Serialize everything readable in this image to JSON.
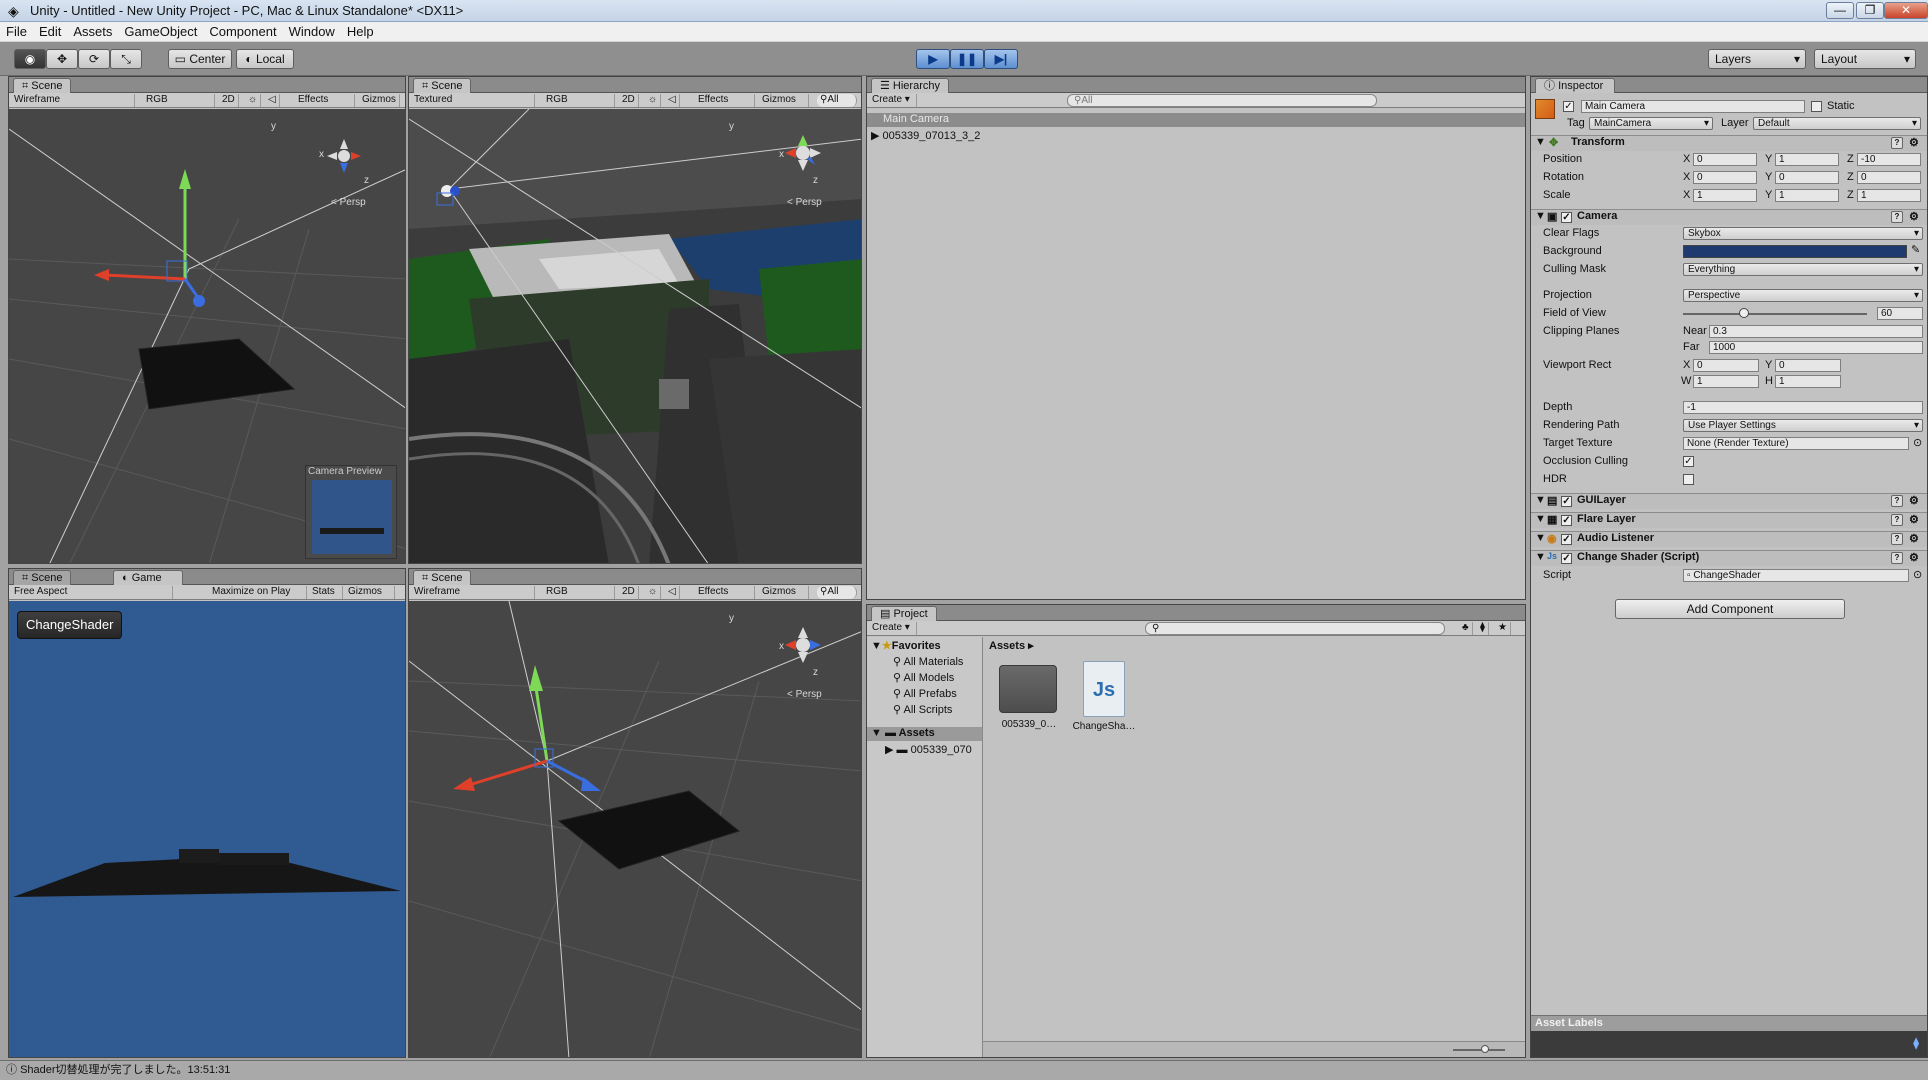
{
  "window": {
    "title": "Unity - Untitled - New Unity Project - PC, Mac & Linux Standalone* <DX11>",
    "minimize": "—",
    "maximize": "❐",
    "close": "✕"
  },
  "menu": [
    "File",
    "Edit",
    "Assets",
    "GameObject",
    "Component",
    "Window",
    "Help"
  ],
  "toolbar": {
    "tools": [
      "hand-icon",
      "move-icon",
      "rotate-icon",
      "scale-icon"
    ],
    "pivot": "Center",
    "space": "Local",
    "play": "▶",
    "pause": "❚❚",
    "step": "▶|",
    "layers": "Layers",
    "layout": "Layout"
  },
  "scene_top_left": {
    "tab": "Scene",
    "draw_mode": "Wireframe",
    "rgb": "RGB",
    "btn_2d": "2D",
    "effects": "Effects",
    "gizmos": "Gizmos",
    "persp": "Persp",
    "gizmo_x": "x",
    "gizmo_y": "y",
    "gizmo_z": "z",
    "camera_preview": "Camera Preview"
  },
  "scene_top_mid": {
    "tab": "Scene",
    "draw_mode": "Textured",
    "rgb": "RGB",
    "btn_2d": "2D",
    "effects": "Effects",
    "gizmos": "Gizmos",
    "search": "All",
    "persp": "Persp",
    "gizmo_x": "x",
    "gizmo_y": "y",
    "gizmo_z": "z"
  },
  "game_panel": {
    "tab_scene": "Scene",
    "tab_game": "Game",
    "aspect": "Free Aspect",
    "maximize": "Maximize on Play",
    "stats": "Stats",
    "gizmos": "Gizmos",
    "button": "ChangeShader"
  },
  "scene_bottom_mid": {
    "tab": "Scene",
    "draw_mode": "Wireframe",
    "rgb": "RGB",
    "btn_2d": "2D",
    "effects": "Effects",
    "gizmos": "Gizmos",
    "search": "All",
    "persp": "Persp",
    "gizmo_x": "x",
    "gizmo_y": "y",
    "gizmo_z": "z"
  },
  "hierarchy": {
    "tab": "Hierarchy",
    "create": "Create",
    "search_placeholder": "All",
    "items": [
      "Main Camera",
      "005339_07013_3_2"
    ]
  },
  "project": {
    "tab": "Project",
    "create": "Create",
    "favorites_label": "Favorites",
    "favorites": [
      "All Materials",
      "All Models",
      "All Prefabs",
      "All Scripts"
    ],
    "assets_label": "Assets",
    "assets_tree_item": "005339_070",
    "breadcrumb": "Assets",
    "files": [
      {
        "name": "005339_0…",
        "icon": "folder-icon"
      },
      {
        "name": "ChangeSha…",
        "icon": "js-script-icon"
      }
    ]
  },
  "inspector": {
    "tab": "Inspector",
    "object_name": "Main Camera",
    "static_label": "Static",
    "tag_label": "Tag",
    "tag": "MainCamera",
    "layer_label": "Layer",
    "layer": "Default",
    "transform": {
      "title": "Transform",
      "position_label": "Position",
      "position": {
        "x": "0",
        "y": "1",
        "z": "-10"
      },
      "rotation_label": "Rotation",
      "rotation": {
        "x": "0",
        "y": "0",
        "z": "0"
      },
      "scale_label": "Scale",
      "scale": {
        "x": "1",
        "y": "1",
        "z": "1"
      }
    },
    "camera": {
      "title": "Camera",
      "clear_flags_label": "Clear Flags",
      "clear_flags": "Skybox",
      "background_label": "Background",
      "background_color": "#1e3a6e",
      "culling_mask_label": "Culling Mask",
      "culling_mask": "Everything",
      "projection_label": "Projection",
      "projection": "Perspective",
      "fov_label": "Field of View",
      "fov": "60",
      "fov_fraction": 0.33,
      "clipping_label": "Clipping Planes",
      "near_label": "Near",
      "near": "0.3",
      "far_label": "Far",
      "far": "1000",
      "viewport_label": "Viewport Rect",
      "viewport": {
        "x_label": "X",
        "x": "0",
        "y_label": "Y",
        "y": "0",
        "w_label": "W",
        "w": "1",
        "h_label": "H",
        "h": "1"
      },
      "depth_label": "Depth",
      "depth": "-1",
      "rendering_path_label": "Rendering Path",
      "rendering_path": "Use Player Settings",
      "target_texture_label": "Target Texture",
      "target_texture": "None (Render Texture)",
      "occlusion_label": "Occlusion Culling",
      "occlusion": true,
      "hdr_label": "HDR",
      "hdr": false
    },
    "components": [
      "GUILayer",
      "Flare Layer",
      "Audio Listener",
      "Change Shader (Script)"
    ],
    "script_label": "Script",
    "script_value": "ChangeShader",
    "add_component": "Add Component",
    "asset_labels": "Asset Labels"
  },
  "status": "Shader切替処理が完了しました。13:51:31"
}
